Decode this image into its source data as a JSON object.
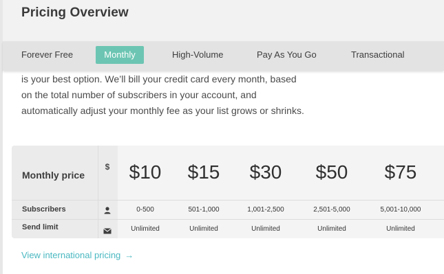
{
  "header": {
    "title": "Pricing Overview"
  },
  "tabs": [
    {
      "label": "Forever Free",
      "active": false
    },
    {
      "label": "Monthly",
      "active": true
    },
    {
      "label": "High-Volume",
      "active": false
    },
    {
      "label": "Pay As You Go",
      "active": false
    },
    {
      "label": "Transactional",
      "active": false
    }
  ],
  "description": [
    "is your best option. We’ll bill your credit card every month, based",
    "on the total number of subscribers in your account, and",
    "automatically adjust your monthly fee as your list grows or shrinks."
  ],
  "pricing": {
    "price_label": "Monthly price",
    "currency_symbol": "$",
    "subscribers_label": "Subscribers",
    "send_limit_label": "Send limit",
    "icons": {
      "price": "dollar-icon",
      "subscribers": "user-icon",
      "send_limit": "envelope-icon"
    },
    "tiers": [
      {
        "price": "$10",
        "subscribers": "0-500",
        "send_limit": "Unlimited"
      },
      {
        "price": "$15",
        "subscribers": "501-1,000",
        "send_limit": "Unlimited"
      },
      {
        "price": "$30",
        "subscribers": "1,001-2,500",
        "send_limit": "Unlimited"
      },
      {
        "price": "$50",
        "subscribers": "2,501-5,000",
        "send_limit": "Unlimited"
      },
      {
        "price": "$75",
        "subscribers": "5,001-10,000",
        "send_limit": "Unlimited"
      }
    ]
  },
  "link": {
    "text": "View international pricing",
    "arrow": "→"
  },
  "colors": {
    "accent": "#6cc5b2",
    "link": "#4ab8c1"
  }
}
